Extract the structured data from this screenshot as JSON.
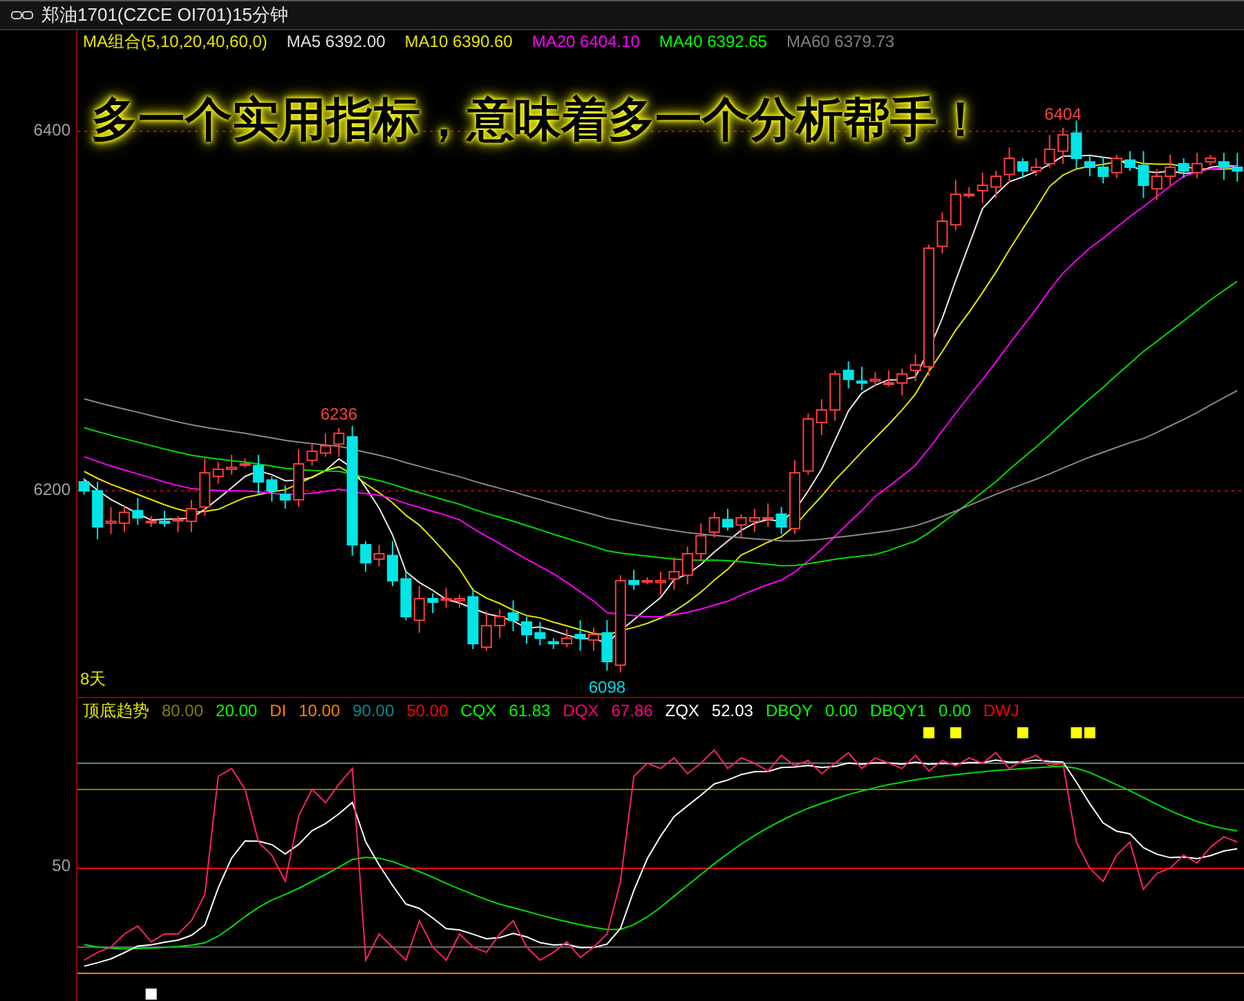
{
  "window": {
    "title": "郑油1701(CZCE OI701)15分钟"
  },
  "main_chart": {
    "legend": [
      {
        "label": "MA组合(5,10,20,40,60,0)",
        "color": "#e6e600"
      },
      {
        "label": "MA5 6392.00",
        "color": "#e0e0e0"
      },
      {
        "label": "MA10 6390.60",
        "color": "#e6e600"
      },
      {
        "label": "MA20 6404.10",
        "color": "#ff00ff"
      },
      {
        "label": "MA40 6392.65",
        "color": "#00ff00"
      },
      {
        "label": "MA60 6379.73",
        "color": "#808080"
      }
    ],
    "banner": "多一个实用指标，意味着多一个分析帮手！",
    "y_axis_labels": [
      "6400",
      "6200"
    ],
    "annotations": [
      {
        "text": "6404",
        "kind": "high"
      },
      {
        "text": "6236",
        "kind": "peak"
      },
      {
        "text": "6098",
        "kind": "low"
      }
    ],
    "period_label": "8天"
  },
  "indicator": {
    "legend": [
      {
        "label": "顶底趋势",
        "color": "#e6e600"
      },
      {
        "label": "80.00",
        "color": "#808000"
      },
      {
        "label": "20.00",
        "color": "#00ff00"
      },
      {
        "label": "DI",
        "color": "#ff8000"
      },
      {
        "label": "10.00",
        "color": "#ff8000"
      },
      {
        "label": "90.00",
        "color": "#008b8b"
      },
      {
        "label": "50.00",
        "color": "#ff0000"
      },
      {
        "label": "CQX",
        "color": "#00ff00"
      },
      {
        "label": "61.83",
        "color": "#00ff00"
      },
      {
        "label": "DQX",
        "color": "#ff0080"
      },
      {
        "label": "67.86",
        "color": "#ff0080"
      },
      {
        "label": "ZQX",
        "color": "#ffffff"
      },
      {
        "label": "52.03",
        "color": "#ffffff"
      },
      {
        "label": "DBQY",
        "color": "#00ff00"
      },
      {
        "label": "0.00",
        "color": "#00ff00"
      },
      {
        "label": "DBQY1",
        "color": "#00ff00"
      },
      {
        "label": "0.00",
        "color": "#00ff00"
      },
      {
        "label": "DWJ",
        "color": "#ff0000"
      }
    ],
    "y_axis_labels": [
      "50"
    ]
  }
}
